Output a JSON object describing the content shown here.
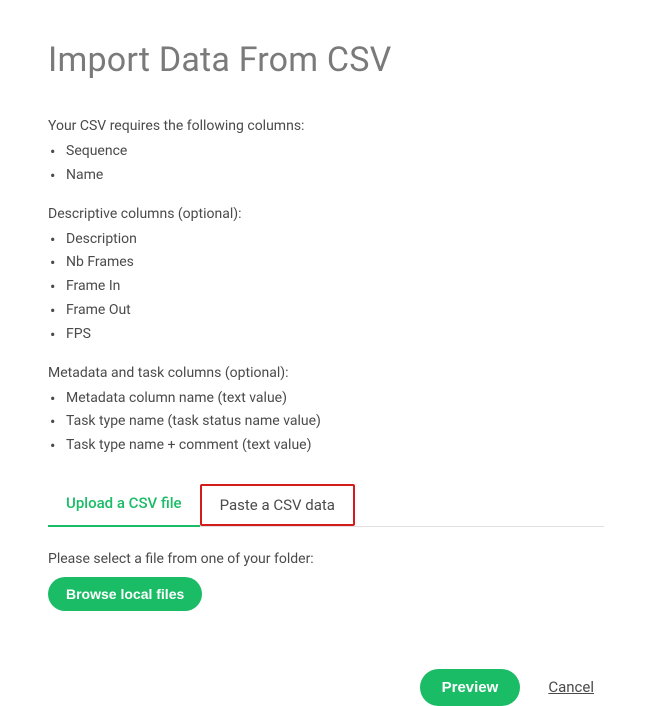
{
  "title": "Import Data From CSV",
  "required": {
    "intro": "Your CSV requires the following columns:",
    "items": [
      "Sequence",
      "Name"
    ]
  },
  "descriptive": {
    "heading": "Descriptive columns (optional):",
    "items": [
      "Description",
      "Nb Frames",
      "Frame In",
      "Frame Out",
      "FPS"
    ]
  },
  "metadata": {
    "heading": "Metadata and task columns (optional):",
    "items": [
      "Metadata column name (text value)",
      "Task type name (task status name value)",
      "Task type name + comment (text value)"
    ]
  },
  "tabs": {
    "upload": "Upload a CSV file",
    "paste": "Paste a CSV data"
  },
  "filePrompt": "Please select a file from one of your folder:",
  "buttons": {
    "browse": "Browse local files",
    "preview": "Preview",
    "cancel": "Cancel"
  }
}
